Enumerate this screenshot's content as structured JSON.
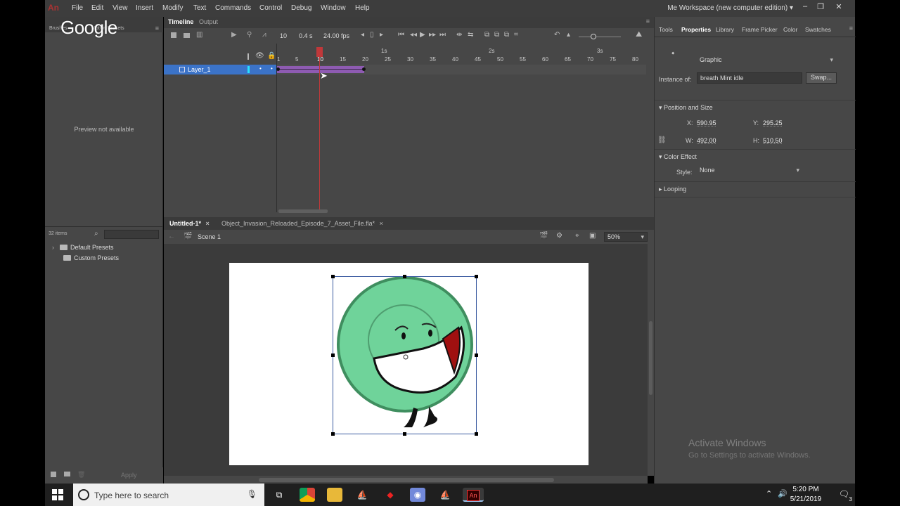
{
  "app": {
    "logo": "An",
    "menu": [
      "File",
      "Edit",
      "View",
      "Insert",
      "Modify",
      "Text",
      "Commands",
      "Control",
      "Debug",
      "Window",
      "Help"
    ],
    "workspace": "Me Workspace (new computer edition)",
    "window_controls": [
      "–",
      "❐",
      "✕"
    ]
  },
  "overlay": {
    "google_logo": "Google"
  },
  "left_panel": {
    "tabs": [
      "Brushes",
      "Motion Presets"
    ],
    "preview_text": "Preview not available"
  },
  "library": {
    "count": "32 items",
    "items": [
      "Default Presets",
      "Custom Presets"
    ],
    "apply": "Apply"
  },
  "timeline": {
    "tabs": [
      "Timeline",
      "Output"
    ],
    "current_frame": "10",
    "seconds": "0.4 s",
    "fps": "24.00 fps",
    "frame_ticks": [
      "1",
      "5",
      "10",
      "15",
      "20",
      "25",
      "30",
      "35",
      "40",
      "45",
      "50",
      "55",
      "60",
      "65",
      "70",
      "75",
      "80"
    ],
    "second_marks": [
      "1s",
      "2s",
      "3s"
    ],
    "layer_name": "Layer_1"
  },
  "documents": {
    "tabs": [
      "Untitled-1*",
      "Object_Invasion_Reloaded_Episode_7_Asset_File.fla*"
    ],
    "scene": "Scene 1",
    "zoom": "50%"
  },
  "properties": {
    "tabs": [
      "Tools",
      "Properties",
      "Library",
      "Frame Picker",
      "Color",
      "Swatches"
    ],
    "symbol_type": "Graphic",
    "instance_of_label": "Instance of:",
    "instance_of": "breath Mint idle",
    "swap": "Swap...",
    "position_section": "Position and Size",
    "x_label": "X:",
    "x": "590.95",
    "y_label": "Y:",
    "y": "295.25",
    "w_label": "W:",
    "w": "492.00",
    "h_label": "H:",
    "h": "510.50",
    "color_section": "Color Effect",
    "style_label": "Style:",
    "style": "None",
    "looping_section": "Looping"
  },
  "watermark": {
    "line1": "Activate Windows",
    "line2": "Go to Settings to activate Windows."
  },
  "taskbar": {
    "search_placeholder": "Type here to search",
    "time": "5:20 PM",
    "date": "5/21/2019",
    "notifications": "3"
  }
}
